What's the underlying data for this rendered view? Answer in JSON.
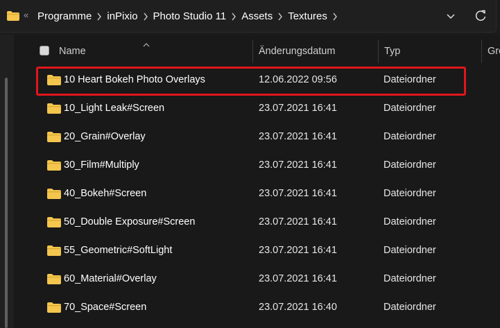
{
  "address_bar": {
    "breadcrumbs": [
      "Programme",
      "inPixio",
      "Photo Studio 11",
      "Assets",
      "Textures"
    ],
    "overflow_glyph": "«",
    "icons": [
      "folder-icon",
      "chevron-right-icon",
      "chevron-down-icon",
      "refresh-icon"
    ]
  },
  "columns": {
    "name": "Name",
    "modified": "Änderungsdatum",
    "type": "Typ",
    "size": "Grö"
  },
  "rows": [
    {
      "name": "10 Heart Bokeh Photo Overlays",
      "modified": "12.06.2022 09:56",
      "type": "Dateiordner",
      "highlighted": true
    },
    {
      "name": "10_Light Leak#Screen",
      "modified": "23.07.2021 16:41",
      "type": "Dateiordner"
    },
    {
      "name": "20_Grain#Overlay",
      "modified": "23.07.2021 16:41",
      "type": "Dateiordner"
    },
    {
      "name": "30_Film#Multiply",
      "modified": "23.07.2021 16:41",
      "type": "Dateiordner"
    },
    {
      "name": "40_Bokeh#Screen",
      "modified": "23.07.2021 16:41",
      "type": "Dateiordner"
    },
    {
      "name": "50_Double Exposure#Screen",
      "modified": "23.07.2021 16:41",
      "type": "Dateiordner"
    },
    {
      "name": "55_Geometric#SoftLight",
      "modified": "23.07.2021 16:41",
      "type": "Dateiordner"
    },
    {
      "name": "60_Material#Overlay",
      "modified": "23.07.2021 16:41",
      "type": "Dateiordner"
    },
    {
      "name": "70_Space#Screen",
      "modified": "23.07.2021 16:40",
      "type": "Dateiordner"
    }
  ],
  "colors": {
    "background": "#191919",
    "folder": "#f4c64e",
    "highlight": "#e0161c"
  }
}
